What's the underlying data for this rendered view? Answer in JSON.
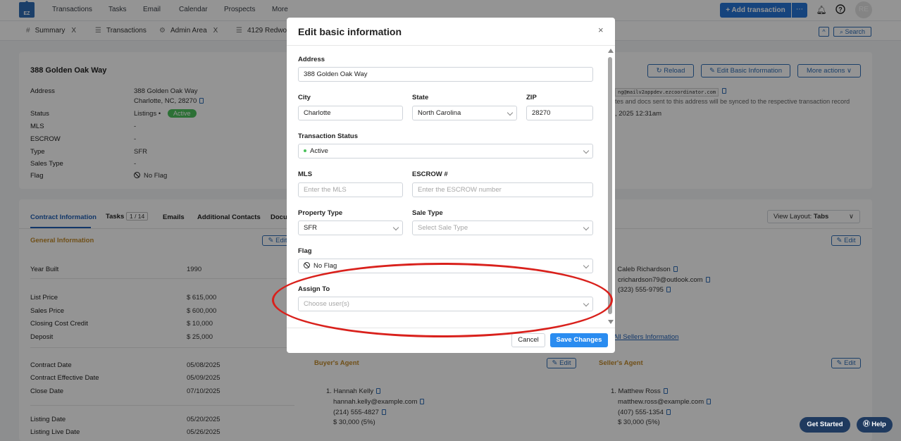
{
  "app": {
    "logo_text": "EZ"
  },
  "topnav": {
    "items": [
      "Transactions",
      "Tasks",
      "Email",
      "Calendar",
      "Prospects",
      "More"
    ],
    "add_transaction": "+ Add transaction",
    "add_more": "⋯",
    "avatar": "RE"
  },
  "tabs": [
    {
      "label": "Summary"
    },
    {
      "label": "Transactions"
    },
    {
      "label": "Admin Area"
    },
    {
      "label": "4129 Redwo"
    }
  ],
  "tabbar_right": {
    "collapse": "^",
    "search": "Search"
  },
  "summary": {
    "title": "388 Golden Oak Way",
    "address_label": "Address",
    "address_line1": "388 Golden Oak Way",
    "address_line2": "Charlotte, NC, 28270",
    "status_label": "Status",
    "status_value": "Listings •",
    "status_badge": "Active",
    "mls_label": "MLS",
    "mls_value": "-",
    "escrow_label": "ESCROW",
    "escrow_value": "-",
    "type_label": "Type",
    "type_value": "SFR",
    "sales_type_label": "Sales Type",
    "sales_type_value": "-",
    "flag_label": "Flag",
    "flag_value": "No Flag",
    "reload": "Reload",
    "edit_basic": "Edit Basic Information",
    "more_actions": "More actions",
    "email_partial": "ng@mailv2appdev.ezcoordinator.com",
    "email_note": "tes and docs sent to this address will be synced to the respective transaction record",
    "date_partial": ", 2025 12:31am"
  },
  "details": {
    "tabs": [
      "Contract Information",
      "Tasks",
      "Emails",
      "Additional Contacts",
      "Docu"
    ],
    "tasks_count": "1 / 14",
    "view_layout": "View Layout:",
    "view_layout_value": "Tabs",
    "general_info": "General Information",
    "edit": "Edit",
    "rows": [
      {
        "label": "Year Built",
        "value": "1990"
      },
      {
        "label": "List Price",
        "value": "$ 615,000"
      },
      {
        "label": "Sales Price",
        "value": "$ 600,000"
      },
      {
        "label": "Closing Cost Credit",
        "value": "$ 10,000"
      },
      {
        "label": "Deposit",
        "value": "$ 25,000"
      },
      {
        "label": "Contract Date",
        "value": "05/08/2025"
      },
      {
        "label": "Contract Effective Date",
        "value": "05/09/2025"
      },
      {
        "label": "Close Date",
        "value": "07/10/2025"
      },
      {
        "label": "Listing Date",
        "value": "05/20/2025"
      },
      {
        "label": "Listing Live Date",
        "value": "05/26/2025"
      }
    ],
    "seller": {
      "name": ". Caleb Richardson",
      "email": "crichardson79@outlook.com",
      "phone": "(323) 555-9795",
      "all_link": "All Sellers Information"
    },
    "buyers_agent": {
      "title": "Buyer's Agent",
      "name": "1. Hannah Kelly",
      "email": "hannah.kelly@example.com",
      "phone": "(214) 555-4827",
      "commission": "$ 30,000  (5%)"
    },
    "sellers_agent": {
      "title": "Seller's Agent",
      "name": "1. Matthew Ross",
      "email": "matthew.ross@example.com",
      "phone": "(407) 555-1354",
      "commission": "$ 30,000  (5%)"
    }
  },
  "modal": {
    "title": "Edit basic information",
    "close": "×",
    "address_label": "Address",
    "address_value": "388 Golden Oak Way",
    "city_label": "City",
    "city_value": "Charlotte",
    "state_label": "State",
    "state_value": "North Carolina",
    "zip_label": "ZIP",
    "zip_value": "28270",
    "status_label": "Transaction Status",
    "status_value": "Active",
    "mls_label": "MLS",
    "mls_placeholder": "Enter the MLS",
    "escrow_label": "ESCROW #",
    "escrow_placeholder": "Enter the ESCROW number",
    "property_type_label": "Property Type",
    "property_type_value": "SFR",
    "sale_type_label": "Sale Type",
    "sale_type_placeholder": "Select Sale Type",
    "flag_label": "Flag",
    "flag_value": "No Flag",
    "assign_label": "Assign To",
    "assign_placeholder": "Choose user(s)",
    "cancel": "Cancel",
    "save": "Save Changes"
  },
  "widgets": {
    "get_started": "Get Started",
    "help": "Help"
  },
  "colors": {
    "primary": "#2776d8",
    "save": "#2a8cf0",
    "active_green": "#4cc15c",
    "section_orange": "#c28a2a",
    "annotation_red": "#d9211c",
    "widget_navy": "#1f3a5f"
  }
}
